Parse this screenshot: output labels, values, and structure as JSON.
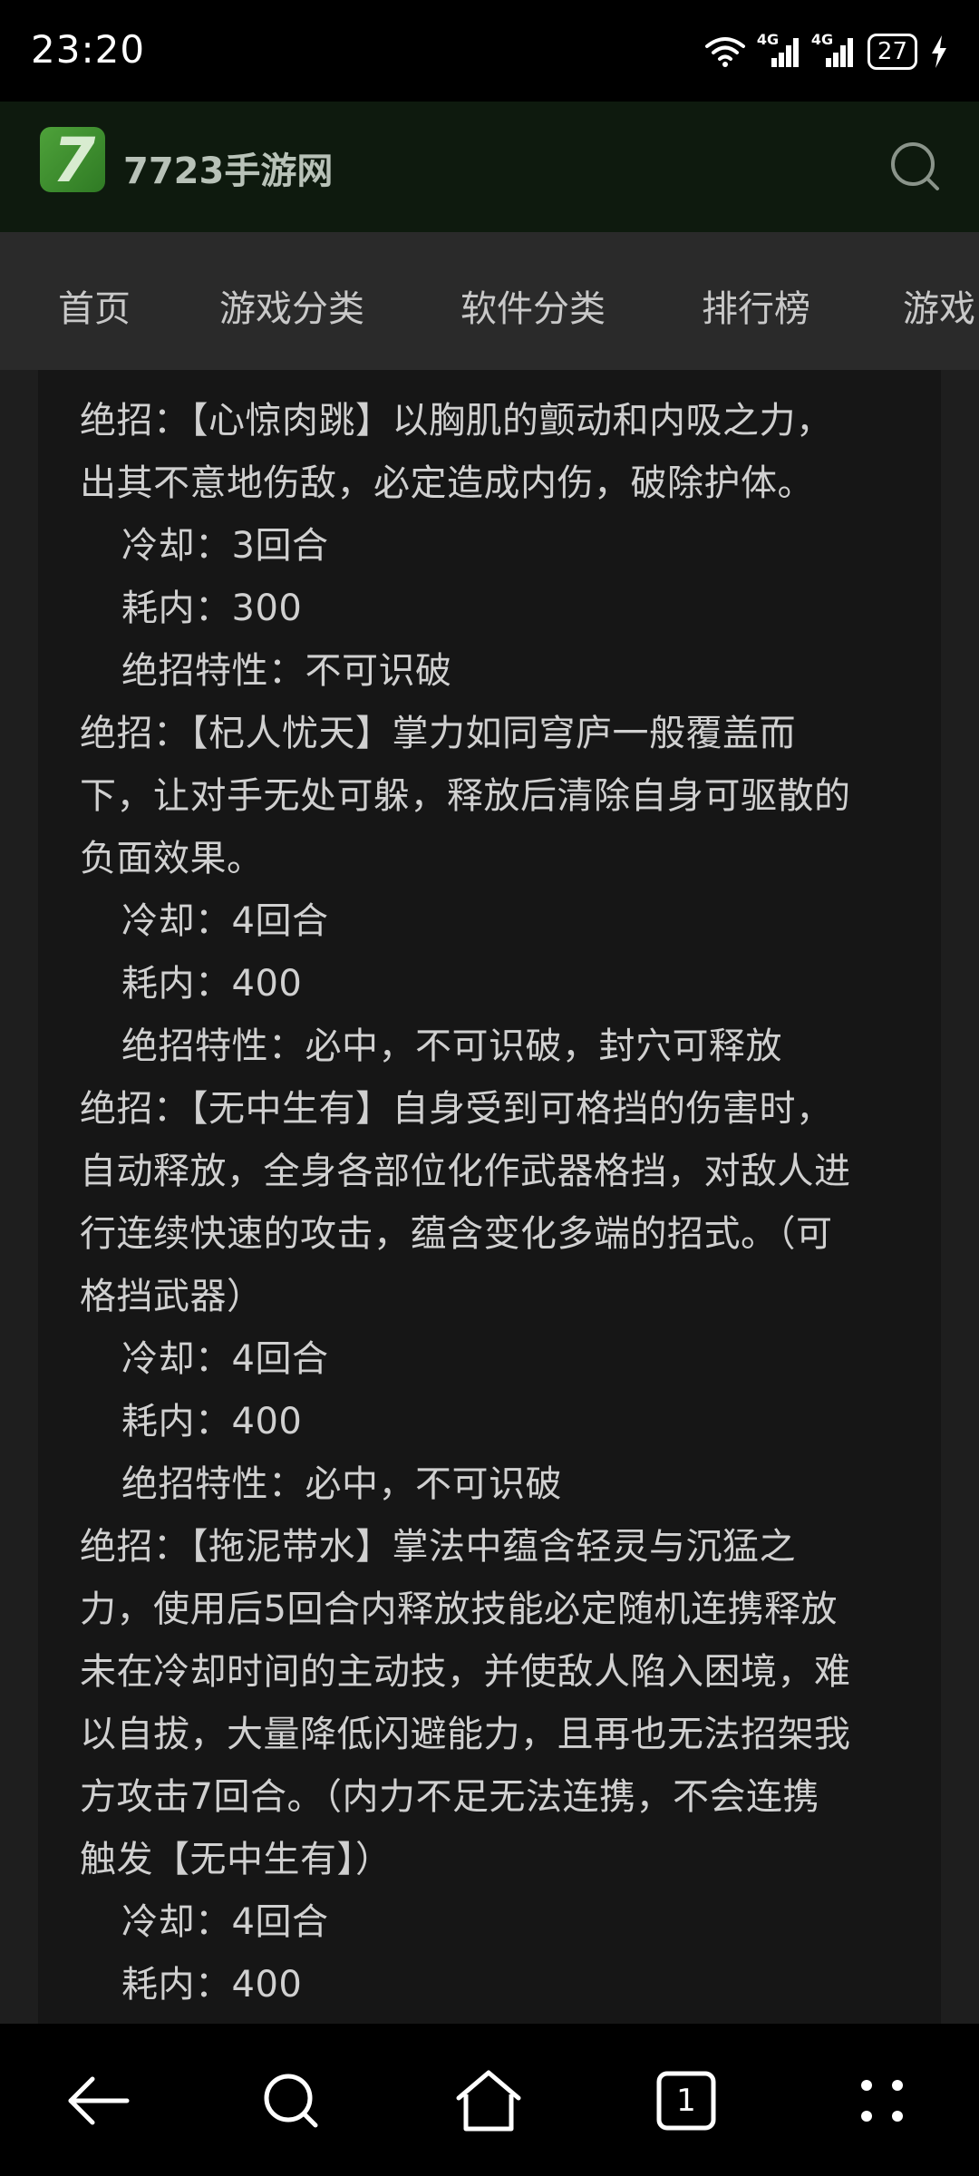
{
  "status_bar": {
    "time": "23:20",
    "wifi_icon": "wifi-icon",
    "signal_label_1": "4G",
    "signal_label_2": "4G",
    "battery_level": "27",
    "charging_icon": "charging-bolt-icon"
  },
  "header": {
    "logo_glyph": "7",
    "site_name": "7723手游网",
    "search_icon": "search-icon"
  },
  "nav": {
    "tabs": [
      "首页",
      "游戏分类",
      "软件分类",
      "排行榜",
      "游戏"
    ]
  },
  "article": {
    "lines": [
      {
        "text": "绝招：【心惊肉跳】以胸肌的颤动和内吸之力，",
        "indent": false
      },
      {
        "text": "出其不意地伤敌，必定造成内伤，破除护体。",
        "indent": false
      },
      {
        "text": "冷却：3回合",
        "indent": true
      },
      {
        "text": "耗内：300",
        "indent": true
      },
      {
        "text": "绝招特性：不可识破",
        "indent": true
      },
      {
        "text": "绝招：【杞人忧天】掌力如同穹庐一般覆盖而",
        "indent": false
      },
      {
        "text": "下，让对手无处可躲，释放后清除自身可驱散的",
        "indent": false
      },
      {
        "text": "负面效果。",
        "indent": false
      },
      {
        "text": "冷却：4回合",
        "indent": true
      },
      {
        "text": "耗内：400",
        "indent": true
      },
      {
        "text": "绝招特性：必中，不可识破，封穴可释放",
        "indent": true
      },
      {
        "text": "绝招：【无中生有】自身受到可格挡的伤害时，",
        "indent": false
      },
      {
        "text": "自动释放，全身各部位化作武器格挡，对敌人进",
        "indent": false
      },
      {
        "text": "行连续快速的攻击，蕴含变化多端的招式。（可",
        "indent": false
      },
      {
        "text": "格挡武器）",
        "indent": false
      },
      {
        "text": "冷却：4回合",
        "indent": true
      },
      {
        "text": "耗内：400",
        "indent": true
      },
      {
        "text": "绝招特性：必中，不可识破",
        "indent": true
      },
      {
        "text": "绝招：【拖泥带水】掌法中蕴含轻灵与沉猛之",
        "indent": false
      },
      {
        "text": "力，使用后5回合内释放技能必定随机连携释放",
        "indent": false
      },
      {
        "text": "未在冷却时间的主动技，并使敌人陷入困境，难",
        "indent": false
      },
      {
        "text": "以自拔，大量降低闪避能力，且再也无法招架我",
        "indent": false
      },
      {
        "text": "方攻击7回合。（内力不足无法连携，不会连携",
        "indent": false
      },
      {
        "text": "触发【无中生有】）",
        "indent": false
      },
      {
        "text": "冷却：4回合",
        "indent": true
      },
      {
        "text": "耗内：400",
        "indent": true
      }
    ]
  },
  "bottom_bar": {
    "back_icon": "back-arrow-icon",
    "search_icon": "search-icon",
    "home_icon": "home-icon",
    "tab_count": "1",
    "menu_icon": "menu-dots-icon"
  }
}
